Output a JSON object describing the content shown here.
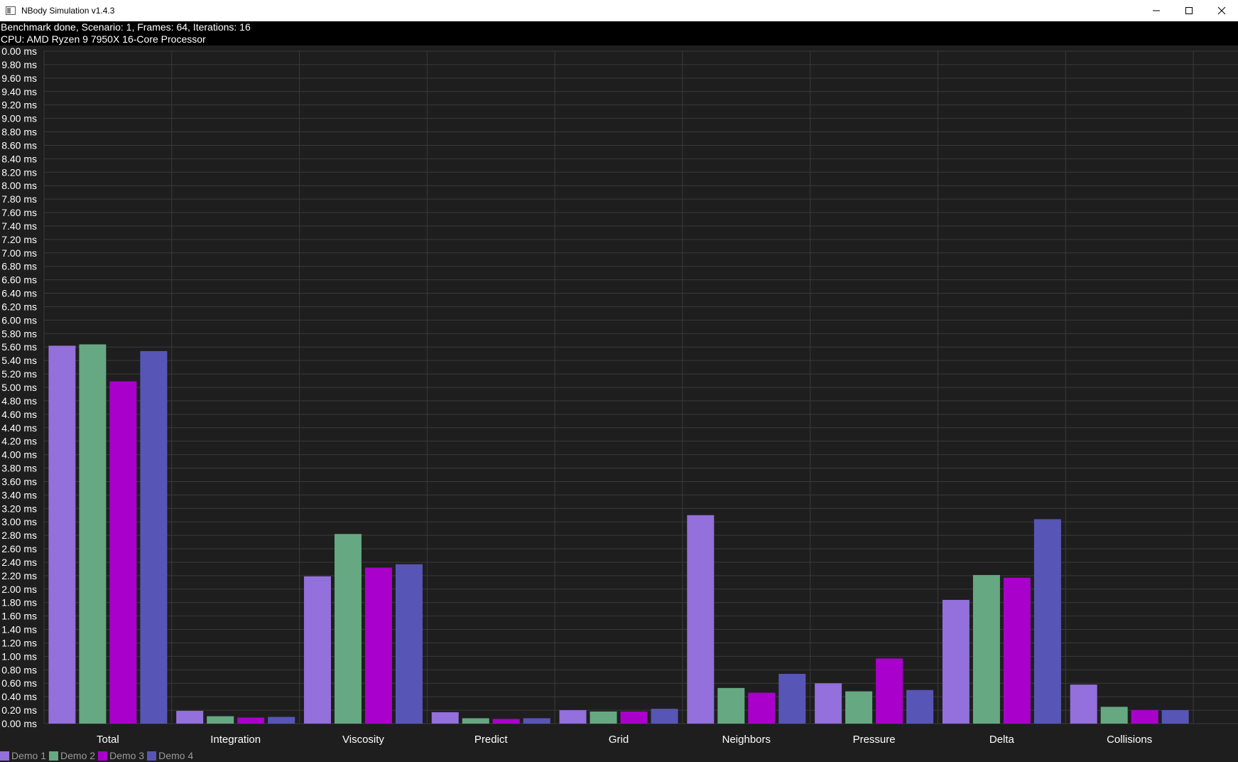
{
  "window": {
    "title": "NBody Simulation v1.4.3",
    "minimize_icon": "minimize-icon",
    "maximize_icon": "maximize-icon",
    "close_icon": "close-icon"
  },
  "info": {
    "line1": "Benchmark done, Scenario: 1, Frames: 64, Iterations: 16",
    "line2": "CPU: AMD Ryzen 9 7950X 16-Core Processor"
  },
  "colors": {
    "background": "#1e1e1e",
    "grid": "#3a3a3a",
    "axis_text": "#ffffff",
    "category_text": "#ffffff"
  },
  "chart_data": {
    "type": "bar",
    "ylabel_suffix": " ms",
    "ylim": [
      0,
      10
    ],
    "ytick_step": 0.2,
    "ytick_labels_top_down": [
      "0.00 ms",
      "9.80 ms",
      "9.60 ms",
      "9.40 ms",
      "9.20 ms",
      "9.00 ms",
      "8.80 ms",
      "8.60 ms",
      "8.40 ms",
      "8.20 ms",
      "8.00 ms",
      "7.80 ms",
      "7.60 ms",
      "7.40 ms",
      "7.20 ms",
      "7.00 ms",
      "6.80 ms",
      "6.60 ms",
      "6.40 ms",
      "6.20 ms",
      "6.00 ms",
      "5.80 ms",
      "5.60 ms",
      "5.40 ms",
      "5.20 ms",
      "5.00 ms",
      "4.80 ms",
      "4.60 ms",
      "4.40 ms",
      "4.20 ms",
      "4.00 ms",
      "3.80 ms",
      "3.60 ms",
      "3.40 ms",
      "3.20 ms",
      "3.00 ms",
      "2.80 ms",
      "2.60 ms",
      "2.40 ms",
      "2.20 ms",
      "2.00 ms",
      "1.80 ms",
      "1.60 ms",
      "1.40 ms",
      "1.20 ms",
      "1.00 ms",
      "0.80 ms",
      "0.60 ms",
      "0.40 ms",
      "0.20 ms",
      "0.00 ms"
    ],
    "grid": true,
    "legend_position": "bottom-left",
    "categories": [
      "Total",
      "Integration",
      "Viscosity",
      "Predict",
      "Grid",
      "Neighbors",
      "Pressure",
      "Delta",
      "Collisions"
    ],
    "series": [
      {
        "name": "Demo 1",
        "color": "#9370db",
        "values": [
          5.62,
          0.19,
          2.19,
          0.17,
          0.2,
          3.1,
          0.6,
          1.84,
          0.58
        ]
      },
      {
        "name": "Demo 2",
        "color": "#66a882",
        "values": [
          5.64,
          0.11,
          2.82,
          0.08,
          0.18,
          0.53,
          0.48,
          2.21,
          0.25
        ]
      },
      {
        "name": "Demo 3",
        "color": "#aa00cc",
        "values": [
          5.09,
          0.09,
          2.32,
          0.07,
          0.18,
          0.46,
          0.97,
          2.17,
          0.2
        ]
      },
      {
        "name": "Demo 4",
        "color": "#5756b6",
        "values": [
          5.54,
          0.1,
          2.37,
          0.08,
          0.22,
          0.74,
          0.5,
          3.04,
          0.2
        ]
      }
    ]
  }
}
